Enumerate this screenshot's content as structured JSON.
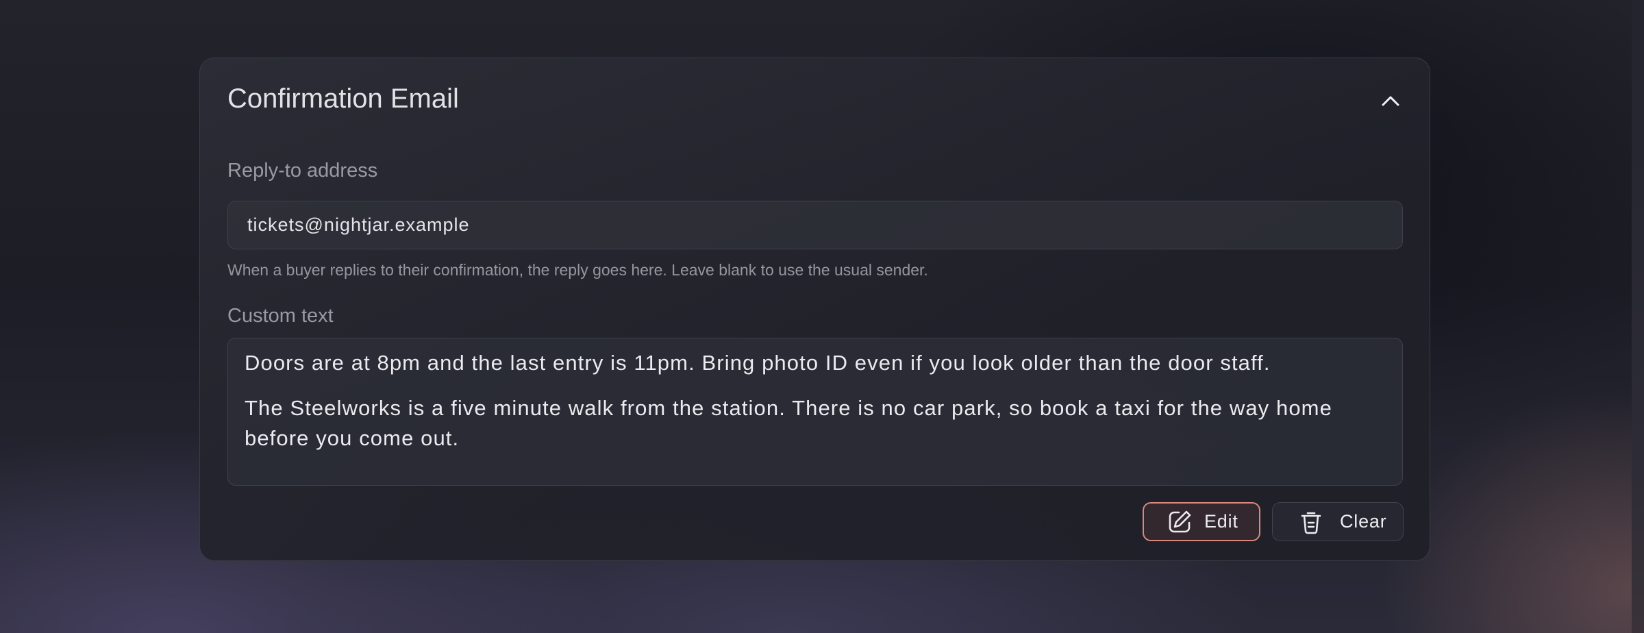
{
  "panel": {
    "title": "Confirmation Email",
    "collapse_icon": "chevron-up-icon"
  },
  "reply_to": {
    "label": "Reply-to address",
    "value": "tickets@nightjar.example",
    "hint": "When a buyer replies to their confirmation, the reply goes here. Leave blank to use the usual sender."
  },
  "custom_text": {
    "label": "Custom text",
    "paragraphs": [
      "Doors are at 8pm and the last entry is 11pm. Bring photo ID even if you look older than the door staff.",
      "The Steelworks is a five minute walk from the station. There is no car park, so book a taxi for the way home before you come out."
    ]
  },
  "actions": {
    "edit_label": "Edit",
    "edit_icon": "edit-icon",
    "clear_label": "Clear",
    "clear_icon": "trash-icon"
  },
  "colors": {
    "accent_border": "#d9897f",
    "panel_border": "#3a3b45"
  }
}
